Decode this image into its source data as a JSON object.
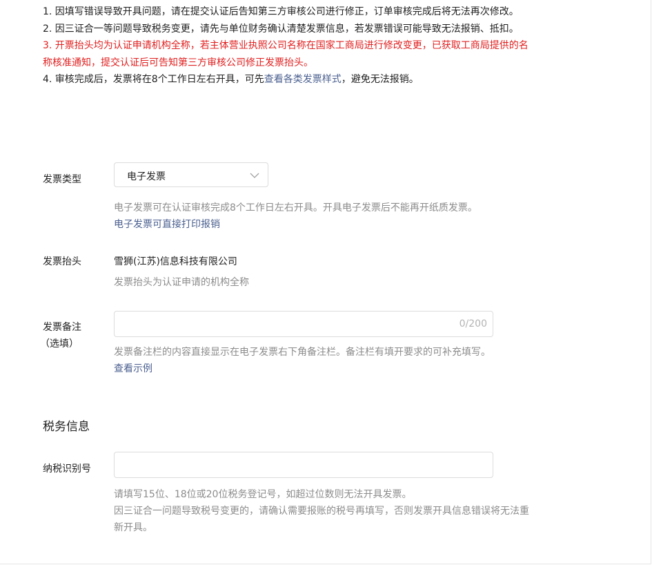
{
  "notice": {
    "item1": "1. 因填写错误导致开具问题，请在提交认证后告知第三方审核公司进行修正，订单审核完成后将无法再次修改。",
    "item2": "2. 因三证合一等问题导致税务变更，请先与单位财务确认清楚发票信息，若发票错误可能导致无法报销、抵扣。",
    "item3": "3. 开票抬头均为认证申请机构全称，若主体营业执照公司名称在国家工商局进行修改变更，已获取工商局提供的名称核准通知，提交认证后可告知第三方审核公司修正发票抬头。",
    "item4_prefix": "4. 审核完成后，发票将在8个工作日左右开具，可先",
    "item4_link": "查看各类发票样式",
    "item4_suffix": "，避免无法报销。"
  },
  "invoice_type": {
    "label": "发票类型",
    "selected": "电子发票",
    "hint": "电子发票可在认证审核完成8个工作日左右开具。开具电子发票后不能再开纸质发票。",
    "link": "电子发票可直接打印报销"
  },
  "invoice_title": {
    "label": "发票抬头",
    "value": "雪狮(江苏)信息科技有限公司",
    "hint": "发票抬头为认证申请的机构全称"
  },
  "invoice_remark": {
    "label_line1": "发票备注",
    "label_line2": "（选填）",
    "value": "",
    "counter": "0/200",
    "hint": "发票备注栏的内容直接显示在电子发票右下角备注栏。备注栏有填开要求的可补充填写。",
    "link": "查看示例"
  },
  "tax_section": {
    "title": "税务信息"
  },
  "tax_id": {
    "label": "纳税识别号",
    "value": "",
    "hint_line1": "请填写15位、18位或20位税务登记号，如超过位数则无法开具发票。",
    "hint_line2": "因三证合一问题导致税号变更的，请确认需要报账的税号再填写，否则发票开具信息错误将无法重新开具。"
  },
  "colors": {
    "warning_red": "#e02020",
    "link_blue": "#4a5f8f",
    "hint_gray": "#8c8c8c"
  }
}
